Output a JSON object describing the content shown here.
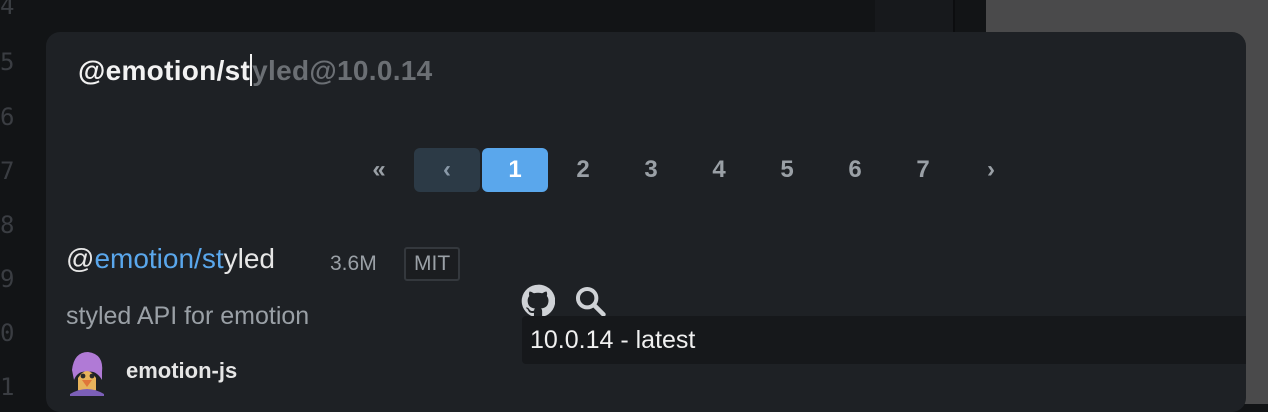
{
  "gutter": {
    "line_numbers": [
      "4",
      "5",
      "6",
      "7",
      "8",
      "9",
      "0",
      "1"
    ]
  },
  "search": {
    "typed": "@emotion/st",
    "ghost_completion": "yled@10.0.14"
  },
  "pagination": {
    "first": "«",
    "prev": "‹",
    "pages": [
      "1",
      "2",
      "3",
      "4",
      "5",
      "6",
      "7"
    ],
    "next": "›",
    "current": "1"
  },
  "result": {
    "name_prefix": "@",
    "name_match": "emotion/st",
    "name_rest": "yled",
    "size": "3.6M",
    "license": "MIT",
    "description": "styled API for emotion",
    "author": "emotion-js",
    "version": "10.0.14 - latest"
  },
  "icons": {
    "repo": "github-icon",
    "search": "search-icon"
  },
  "colors": {
    "accent": "#5aa7ec",
    "panel": "#1e2125",
    "active_page": "#5aa7ec",
    "prev_page": "#2c3a46"
  }
}
